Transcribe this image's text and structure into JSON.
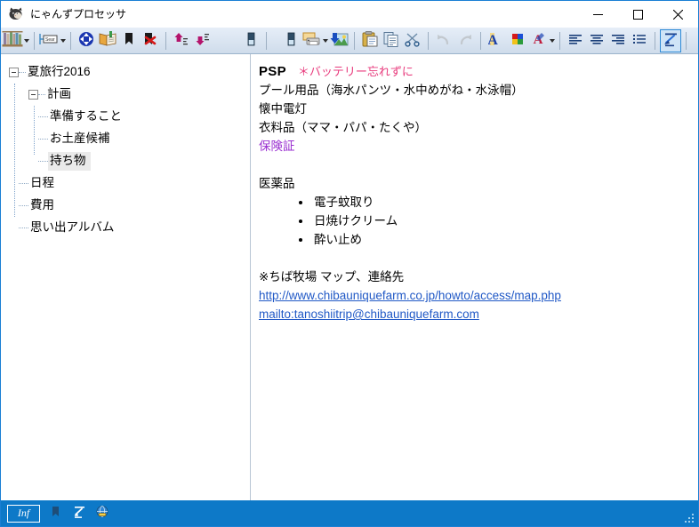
{
  "window": {
    "title": "にゃんずプロセッサ",
    "app_icon": "cat-icon",
    "minimize_label": "—",
    "maximize_label": "□",
    "close_label": "✕"
  },
  "toolbar": {
    "left_group": [
      {
        "name": "bookshelf-button",
        "icon": "bookshelf-icon",
        "dropdown": true
      },
      {
        "name": "label-field-button",
        "icon": "text-field-icon",
        "dropdown": true
      },
      {
        "name": "navigate-button",
        "icon": "blue-four-arrows-icon",
        "dropdown": false
      },
      {
        "name": "open-book-button",
        "icon": "open-book-icon",
        "dropdown": false
      },
      {
        "name": "bookmark-add-button",
        "icon": "bookmark-icon",
        "dropdown": false
      },
      {
        "name": "bookmark-delete-button",
        "icon": "bookmark-delete-icon",
        "dropdown": false
      },
      {
        "name": "move-up-button",
        "icon": "arrow-up-outdent-icon",
        "dropdown": false
      },
      {
        "name": "move-down-button",
        "icon": "arrow-down-indent-icon",
        "dropdown": false
      },
      {
        "name": "toggle-panel-button",
        "icon": "panel-toggle-icon",
        "dropdown": false
      }
    ],
    "right_group": [
      {
        "name": "toggle-doc-panel-button",
        "icon": "panel-toggle-icon",
        "dropdown": false
      },
      {
        "name": "print-button",
        "icon": "printer-icon",
        "dropdown": true
      },
      {
        "name": "insert-image-button",
        "icon": "image-download-icon",
        "dropdown": false
      },
      {
        "name": "paste-button",
        "icon": "clipboard-paste-icon",
        "dropdown": false
      },
      {
        "name": "copy-button",
        "icon": "copy-documents-icon",
        "dropdown": false
      },
      {
        "name": "cut-button",
        "icon": "scissors-icon",
        "dropdown": false
      },
      {
        "name": "undo-button",
        "icon": "undo-arrow-icon",
        "dropdown": false,
        "disabled": true
      },
      {
        "name": "redo-button",
        "icon": "redo-arrow-icon",
        "dropdown": false,
        "disabled": true
      },
      {
        "name": "font-button",
        "icon": "font-letter-a-icon",
        "dropdown": false
      },
      {
        "name": "color-palette-button",
        "icon": "color-squares-icon",
        "dropdown": false
      },
      {
        "name": "text-color-button",
        "icon": "red-letter-a-icon",
        "dropdown": true
      },
      {
        "name": "align-left-button",
        "icon": "align-left-icon",
        "dropdown": false
      },
      {
        "name": "align-center-button",
        "icon": "align-center-icon",
        "dropdown": false
      },
      {
        "name": "align-right-button",
        "icon": "align-right-icon",
        "dropdown": false
      },
      {
        "name": "bullet-list-button",
        "icon": "bullet-list-icon",
        "dropdown": false
      },
      {
        "name": "hyperlink-button",
        "icon": "hyperlink-icon",
        "dropdown": false,
        "active": true
      },
      {
        "name": "help-button",
        "icon": "home-help-icon",
        "dropdown": true
      }
    ]
  },
  "tree": {
    "nodes": [
      {
        "label": "夏旅行2016",
        "level": 0,
        "expander": "minus",
        "selected": false
      },
      {
        "label": "計画",
        "level": 1,
        "expander": "minus",
        "selected": false
      },
      {
        "label": "準備すること",
        "level": 2,
        "expander": "none",
        "selected": false
      },
      {
        "label": "お土産候補",
        "level": 2,
        "expander": "none",
        "selected": false
      },
      {
        "label": "持ち物",
        "level": 2,
        "expander": "none",
        "selected": true
      },
      {
        "label": "日程",
        "level": 1,
        "expander": "none",
        "selected": false
      },
      {
        "label": "費用",
        "level": 1,
        "expander": "none",
        "selected": false
      },
      {
        "label": "思い出アルバム",
        "level": 1,
        "expander": "none",
        "selected": false
      }
    ]
  },
  "document": {
    "line_psp": "PSP",
    "line_psp_note": "＊バッテリー忘れずに",
    "line_pool": "プール用品（海水パンツ・水中めがね・水泳帽）",
    "line_flashlight": "懐中電灯",
    "line_clothes": "衣料品（ママ・パパ・たくや）",
    "line_insurance": "保険証",
    "heading_medicine": "医薬品",
    "medicine_items": [
      "電子蚊取り",
      "日焼けクリーム",
      "酔い止め"
    ],
    "line_map_note": "※ちば牧場 マップ、連絡先",
    "link_url": "http://www.chibauniquefarm.co.jp/howto/access/map.php",
    "link_mail": "mailto:tanoshiitrip@chibauniquefarm.com"
  },
  "statusbar": {
    "inf_label": "Inf",
    "icons": [
      {
        "name": "bookmark-icon"
      },
      {
        "name": "hyperlink-icon"
      },
      {
        "name": "globe-link-icon"
      }
    ]
  },
  "colors": {
    "accent_blue": "#0d79c8",
    "toolbar_bg": "#d6e3f2",
    "note_pink": "#e83a7c",
    "purple": "#9a2fd0",
    "link_blue": "#2159c6",
    "selection_gray": "#eaeaea",
    "window_border": "#1a7fd4"
  }
}
